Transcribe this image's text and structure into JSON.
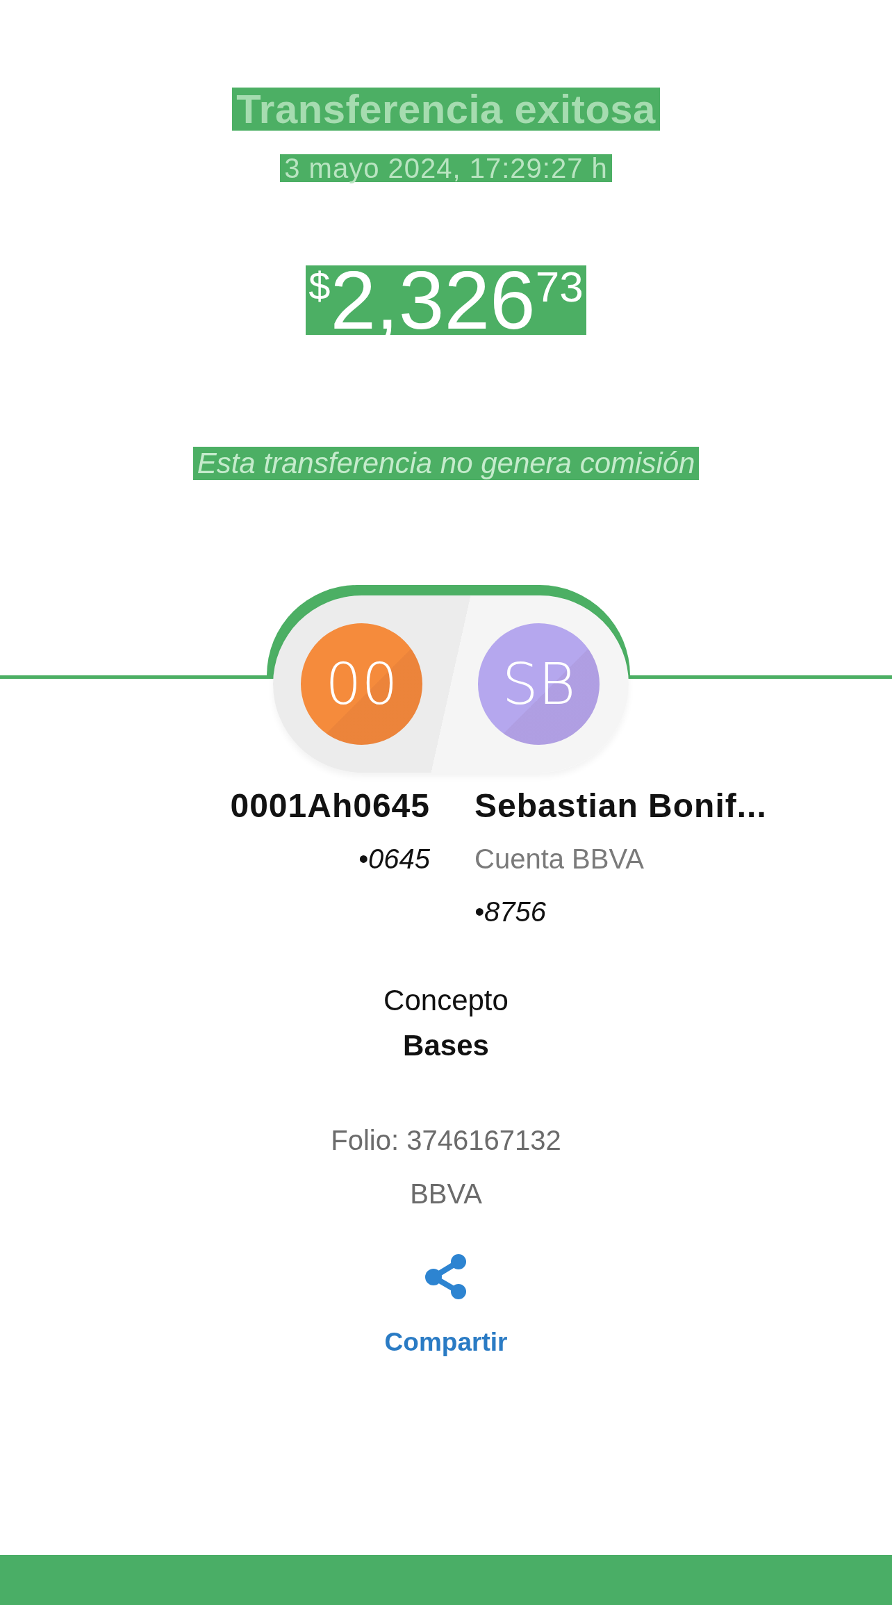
{
  "header": {
    "title": "Transferencia exitosa",
    "datetime": "3 mayo 2024, 17:29:27 h",
    "amount": {
      "currency": "$",
      "whole": "2,326",
      "cents": "73"
    },
    "note": "Esta transferencia no genera comisión"
  },
  "parties": [
    {
      "initials": "00",
      "color": "#f58b3c",
      "name": "0001Ah0645",
      "account": "•0645"
    },
    {
      "initials": "SB",
      "color": "#b5a7ee",
      "name": "Sebastian Bonif...",
      "bank": "Cuenta BBVA",
      "account": "•8756"
    }
  ],
  "concept": {
    "label": "Concepto",
    "value": "Bases"
  },
  "folio": "Folio: 3746167132",
  "bank": "BBVA",
  "share": {
    "label": "Compartir"
  }
}
